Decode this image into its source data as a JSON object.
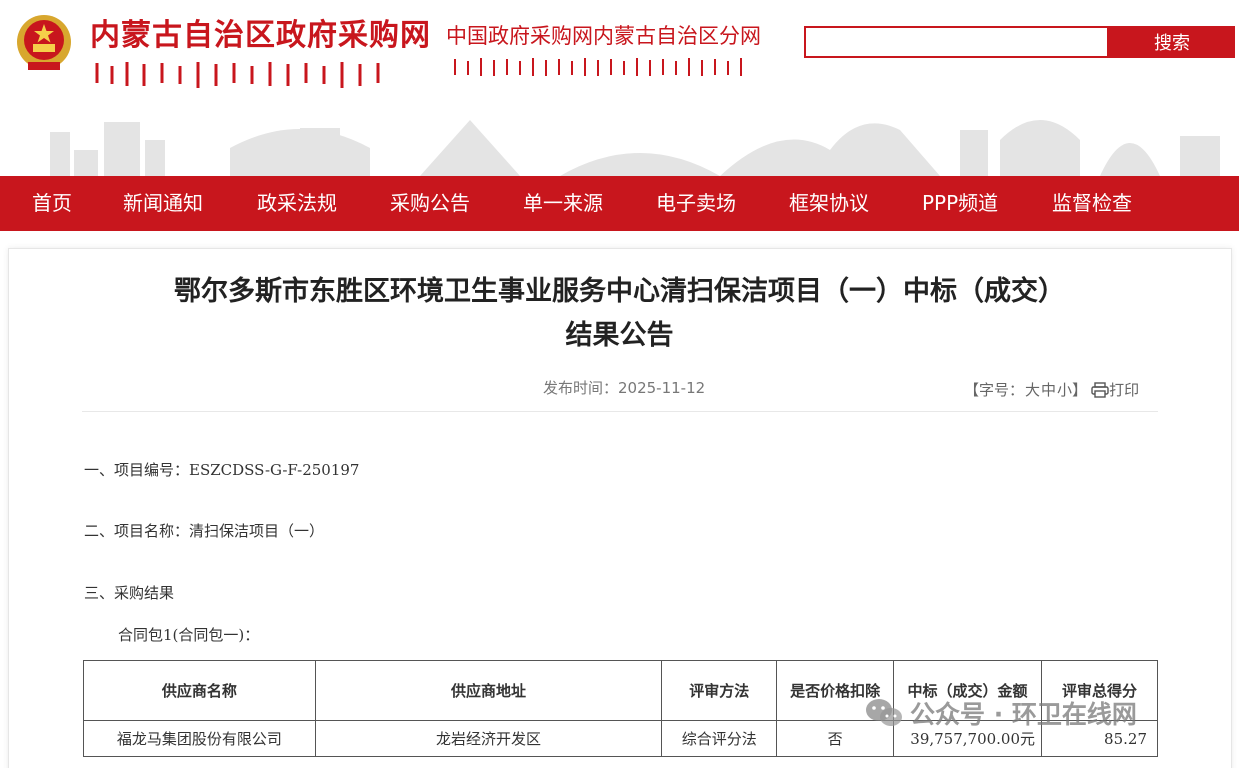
{
  "header": {
    "site_title": "内蒙古自治区政府采购网",
    "site_subtitle": "中国政府采购网内蒙古自治区分网",
    "search_placeholder": "",
    "search_button": "搜索"
  },
  "nav": {
    "items": [
      {
        "label": "首页"
      },
      {
        "label": "新闻通知"
      },
      {
        "label": "政采法规"
      },
      {
        "label": "采购公告"
      },
      {
        "label": "单一来源"
      },
      {
        "label": "电子卖场"
      },
      {
        "label": "框架协议"
      },
      {
        "label": "PPP频道"
      },
      {
        "label": "监督检查"
      }
    ]
  },
  "article": {
    "title_line1": "鄂尔多斯市东胜区环境卫生事业服务中心清扫保洁项目（一）中标（成交）",
    "title_line2": "结果公告",
    "publish_time": "发布时间：2025-11-12",
    "font_size_prefix": "【字号：",
    "font_large": "大",
    "font_medium": "中",
    "font_small": "小",
    "font_size_suffix": "】",
    "print_label": "打印",
    "sections": {
      "project_no": "一、项目编号：ESZCDSS-G-F-250197",
      "project_name": "二、项目名称：清扫保洁项目（一）",
      "result": "三、采购结果"
    },
    "package_label": "合同包1(合同包一)：",
    "table": {
      "headers": [
        "供应商名称",
        "供应商地址",
        "评审方法",
        "是否价格扣除",
        "中标（成交）金额",
        "评审总得分"
      ],
      "rows": [
        [
          "福龙马集团股份有限公司",
          "龙岩经济开发区",
          "综合评分法",
          "否",
          "39,757,700.00元",
          "85.27"
        ]
      ]
    }
  },
  "watermark": {
    "text": "公众号 · 环卫在线网"
  },
  "colors": {
    "brand_red": "#c8161d"
  }
}
